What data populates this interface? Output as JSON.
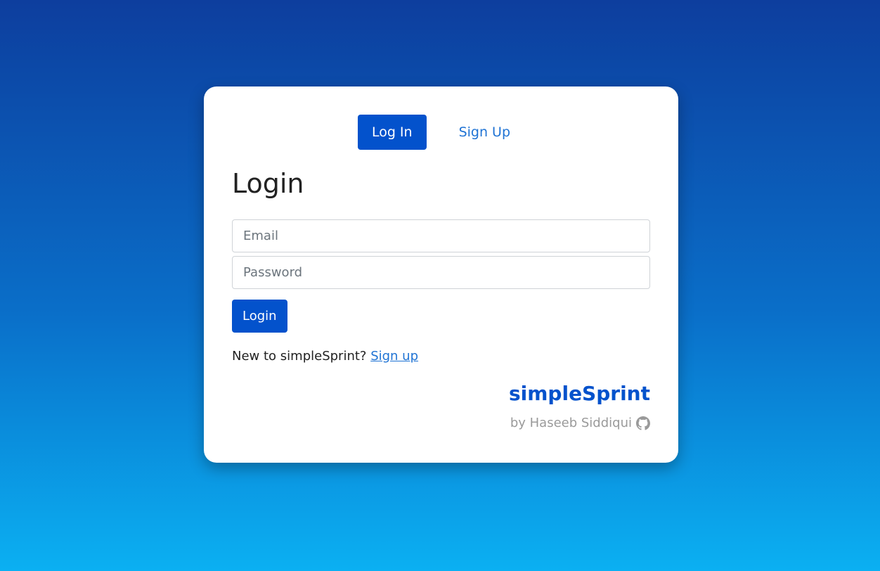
{
  "tabs": {
    "login_label": "Log In",
    "signup_label": "Sign Up"
  },
  "form": {
    "heading": "Login",
    "email_placeholder": "Email",
    "password_placeholder": "Password",
    "submit_label": "Login",
    "signup_prompt": "New to simpleSprint?",
    "signup_link": "Sign up"
  },
  "footer": {
    "brand": "simpleSprint",
    "byline": "by Haseeb Siddiqui",
    "icon": "github-icon"
  },
  "colors": {
    "primary": "#0352cc",
    "link": "#1f73d4"
  }
}
